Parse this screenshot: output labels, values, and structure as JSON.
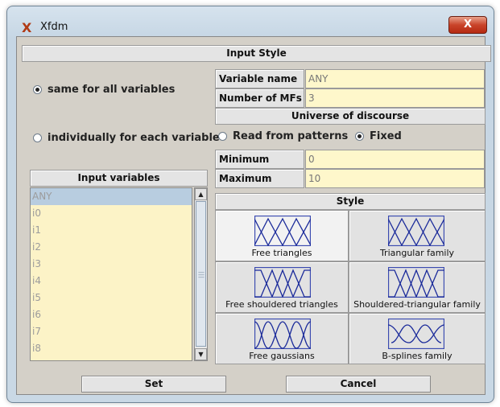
{
  "window": {
    "title": "Xfdm",
    "close_glyph": "X",
    "app_icon": "X"
  },
  "input_style": {
    "header": "Input Style"
  },
  "mode": {
    "same": "same for all variables",
    "individual": "individually for each variable",
    "selected": "same"
  },
  "fields": {
    "variable_name": {
      "label": "Variable name",
      "value": "ANY"
    },
    "number_of_mfs": {
      "label": "Number of MFs",
      "value": "3"
    }
  },
  "universe": {
    "header": "Universe of discourse",
    "read_from_patterns": "Read from patterns",
    "fixed": "Fixed",
    "selected": "fixed",
    "minimum": {
      "label": "Minimum",
      "value": "0"
    },
    "maximum": {
      "label": "Maximum",
      "value": "10"
    }
  },
  "input_variables": {
    "header": "Input variables",
    "items": [
      "ANY",
      "i0",
      "i1",
      "i2",
      "i3",
      "i4",
      "i5",
      "i6",
      "i7",
      "i8"
    ],
    "selected_index": 0
  },
  "style": {
    "header": "Style",
    "options": [
      {
        "caption": "Free triangles",
        "icon": "triangles-icon"
      },
      {
        "caption": "Triangular family",
        "icon": "triangles-icon"
      },
      {
        "caption": "Free shouldered triangles",
        "icon": "shouldered-triangles-icon"
      },
      {
        "caption": "Shouldered-triangular family",
        "icon": "shouldered-triangles-icon"
      },
      {
        "caption": "Free gaussians",
        "icon": "gaussians-icon"
      },
      {
        "caption": "B-splines family",
        "icon": "bsplines-icon"
      }
    ],
    "selected_index": 0
  },
  "buttons": {
    "set": "Set",
    "cancel": "Cancel"
  },
  "colors": {
    "field_bg": "#fef7cb",
    "list_selection": "#b8cde0",
    "panel": "#d4d0c8"
  }
}
